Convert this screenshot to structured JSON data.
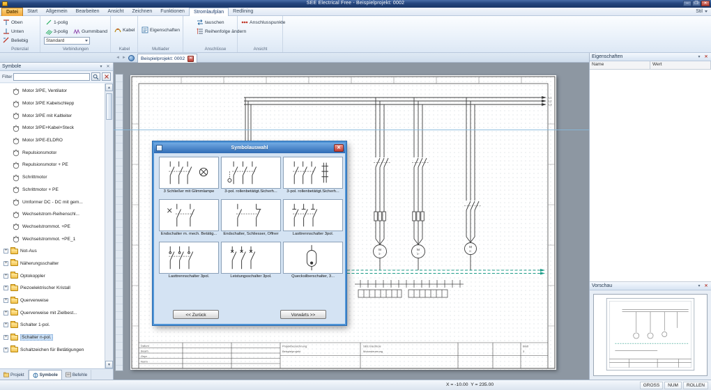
{
  "window": {
    "title": "SEE Electrical Free - Beispielprojekt: 0002"
  },
  "menubar": {
    "tabs": [
      "Datei",
      "Start",
      "Allgemein",
      "Bearbeiten",
      "Ansicht",
      "Zeichnen",
      "Funktionen",
      "Stromlaufplan",
      "Redlining"
    ],
    "active_tab": "Stromlaufplan",
    "style_label": "Stil"
  },
  "ribbon": {
    "potenzial": {
      "label": "Potenzial",
      "oben": "Oben",
      "unten": "Unten",
      "beliebig": "Beliebig"
    },
    "verbindungen": {
      "label": "Verbindungen",
      "einpolig": "1-polig",
      "dreipolig": "3-polig",
      "gummiband": "Gummiband",
      "standard": "Standard"
    },
    "kabel": {
      "label": "Kabel",
      "kabel_button": "Kabel"
    },
    "multiader": {
      "label": "Multiader",
      "eigenschaften": "Eigenschaften"
    },
    "anschluesse": {
      "label": "Anschlüsse",
      "tauschen": "tauschen",
      "reihenfolge": "Reihenfolge ändern"
    },
    "ansicht": {
      "label": "Ansicht",
      "anschlusspunkte": "Anschlusspunkte"
    }
  },
  "doc_tabbar": {
    "tab": "Beispielprojekt: 0002"
  },
  "sidebar": {
    "title": "Symbole",
    "filter_label": "Filter",
    "filter_value": "",
    "items": [
      {
        "label": "Motor 3/PE, Ventilator",
        "type": "symbol"
      },
      {
        "label": "Motor 3/PE Kabelschlepp",
        "type": "symbol"
      },
      {
        "label": "Motor 3/PE mit Kaltleiter",
        "type": "symbol"
      },
      {
        "label": "Motor 3/PE+Kabel+Steck",
        "type": "symbol"
      },
      {
        "label": "Motor 3/PE-ELDRO",
        "type": "symbol"
      },
      {
        "label": "Repulsionsmotor",
        "type": "symbol"
      },
      {
        "label": "Repulsionsmotor + PE",
        "type": "symbol"
      },
      {
        "label": "Schrittmotor",
        "type": "symbol"
      },
      {
        "label": "Schrittmotor + PE",
        "type": "symbol"
      },
      {
        "label": "Umformer DC - DC mit gem...",
        "type": "symbol"
      },
      {
        "label": "Wechselstrom-Reihenschl...",
        "type": "symbol"
      },
      {
        "label": "Wechselstrommot. +PE",
        "type": "symbol"
      },
      {
        "label": "Wechselstrommot. +PE_1",
        "type": "symbol"
      },
      {
        "label": "Not-Aus",
        "type": "folder"
      },
      {
        "label": "Näherungsschalter",
        "type": "folder"
      },
      {
        "label": "Optokoppler",
        "type": "folder"
      },
      {
        "label": "Piezoelektrischer Kristall",
        "type": "folder"
      },
      {
        "label": "Querverweise",
        "type": "folder"
      },
      {
        "label": "Querverweise mit Zielbest...",
        "type": "folder"
      },
      {
        "label": "Schalter 1-pol.",
        "type": "folder"
      },
      {
        "label": "Schalter n-pol.",
        "type": "folder",
        "selected": true
      },
      {
        "label": "Schaltzeichen für Betätigungen",
        "type": "folder"
      }
    ],
    "bottom_tabs": [
      "Projekt",
      "Symbole",
      "Befehle"
    ],
    "active_bottom_tab": "Symbole"
  },
  "dialog": {
    "title": "Symbolauswahl",
    "cells": [
      {
        "label": "3 Schließer mit Glimmlampe",
        "icon": "symbol-3-closer-glow-lamp"
      },
      {
        "label": "3-pol. rollenbetätigt.Sicherh...",
        "icon": "symbol-3pole-roller-safety-1"
      },
      {
        "label": "3-pol. rollenbetätigt.Sicherh...",
        "icon": "symbol-3pole-roller-safety-2"
      },
      {
        "label": "Endschalter m. mech. Betätig...",
        "icon": "symbol-limit-switch-mech"
      },
      {
        "label": "Endschalter, Schliesser, Öffner",
        "icon": "symbol-limit-switch-no-nc"
      },
      {
        "label": "Lasttrennschalter 3pol.",
        "icon": "symbol-load-disconnector-1"
      },
      {
        "label": "Lasttrennschalter 3pol.",
        "icon": "symbol-load-disconnector-2"
      },
      {
        "label": "Leistungsschalter 3pol.",
        "icon": "symbol-circuit-breaker-3pole"
      },
      {
        "label": "Quecksilberschalter, 3...",
        "icon": "symbol-mercury-switch"
      }
    ],
    "back_button": "<< Zurück",
    "forward_button": "Vorwärts >>"
  },
  "properties_panel": {
    "title": "Eigenschaften",
    "columns": [
      "Name",
      "Wert"
    ],
    "rows": []
  },
  "preview_panel": {
    "title": "Vorschau"
  },
  "statusbar": {
    "coordinates": "X = -10.00  Y = 235.00",
    "indicators": [
      "GROSS",
      "NUM",
      "ROLLEN"
    ]
  },
  "schematic": {
    "phase_labels": [
      "L1",
      "L2",
      "L3"
    ],
    "motor_label": "M",
    "motor_phase": "3~",
    "title_block": {
      "row_labels": [
        "Datum",
        "Bearb.",
        "Gepr.",
        "Norm"
      ],
      "project_label": "Projektbezeichnung:",
      "project": "Beispielprojekt",
      "company": "SEE Electrical",
      "description": "Motorsteuerung",
      "sheet_label": "Blatt",
      "sheet": "3"
    }
  }
}
